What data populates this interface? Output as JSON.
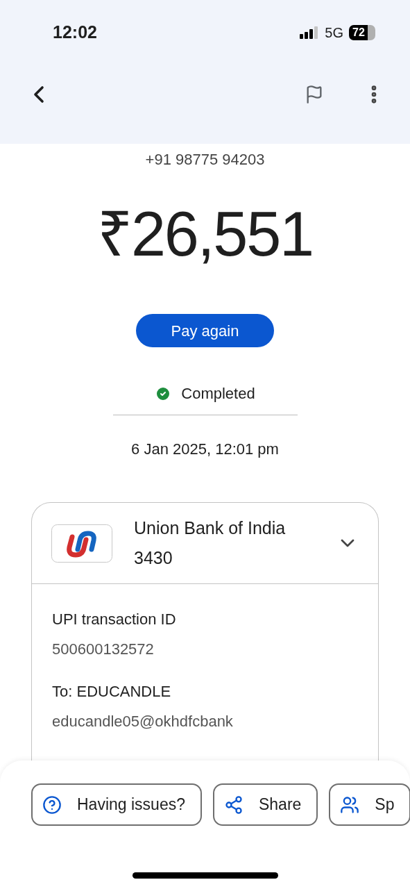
{
  "status_bar": {
    "time": "12:02",
    "network": "5G",
    "battery": "72"
  },
  "header": {
    "phone": "+91 98775 94203",
    "amount": "₹26,551",
    "button": "Pay again",
    "status": {
      "kind": "completed",
      "label": "Completed"
    },
    "date": "6 Jan 2025, 12:01 pm"
  },
  "account": {
    "bank": "Union Bank of India",
    "number": "3430",
    "expanded": false
  },
  "details": [
    {
      "label": "UPI transaction ID",
      "value": "500600132572"
    },
    {
      "label": "To: EDUCANDLE",
      "value": "educandle05@okhdfcbank"
    }
  ],
  "actions": [
    {
      "kind": "help",
      "label": "Having issues?"
    },
    {
      "kind": "share",
      "label": "Share"
    },
    {
      "kind": "split",
      "label": "Sp"
    }
  ]
}
